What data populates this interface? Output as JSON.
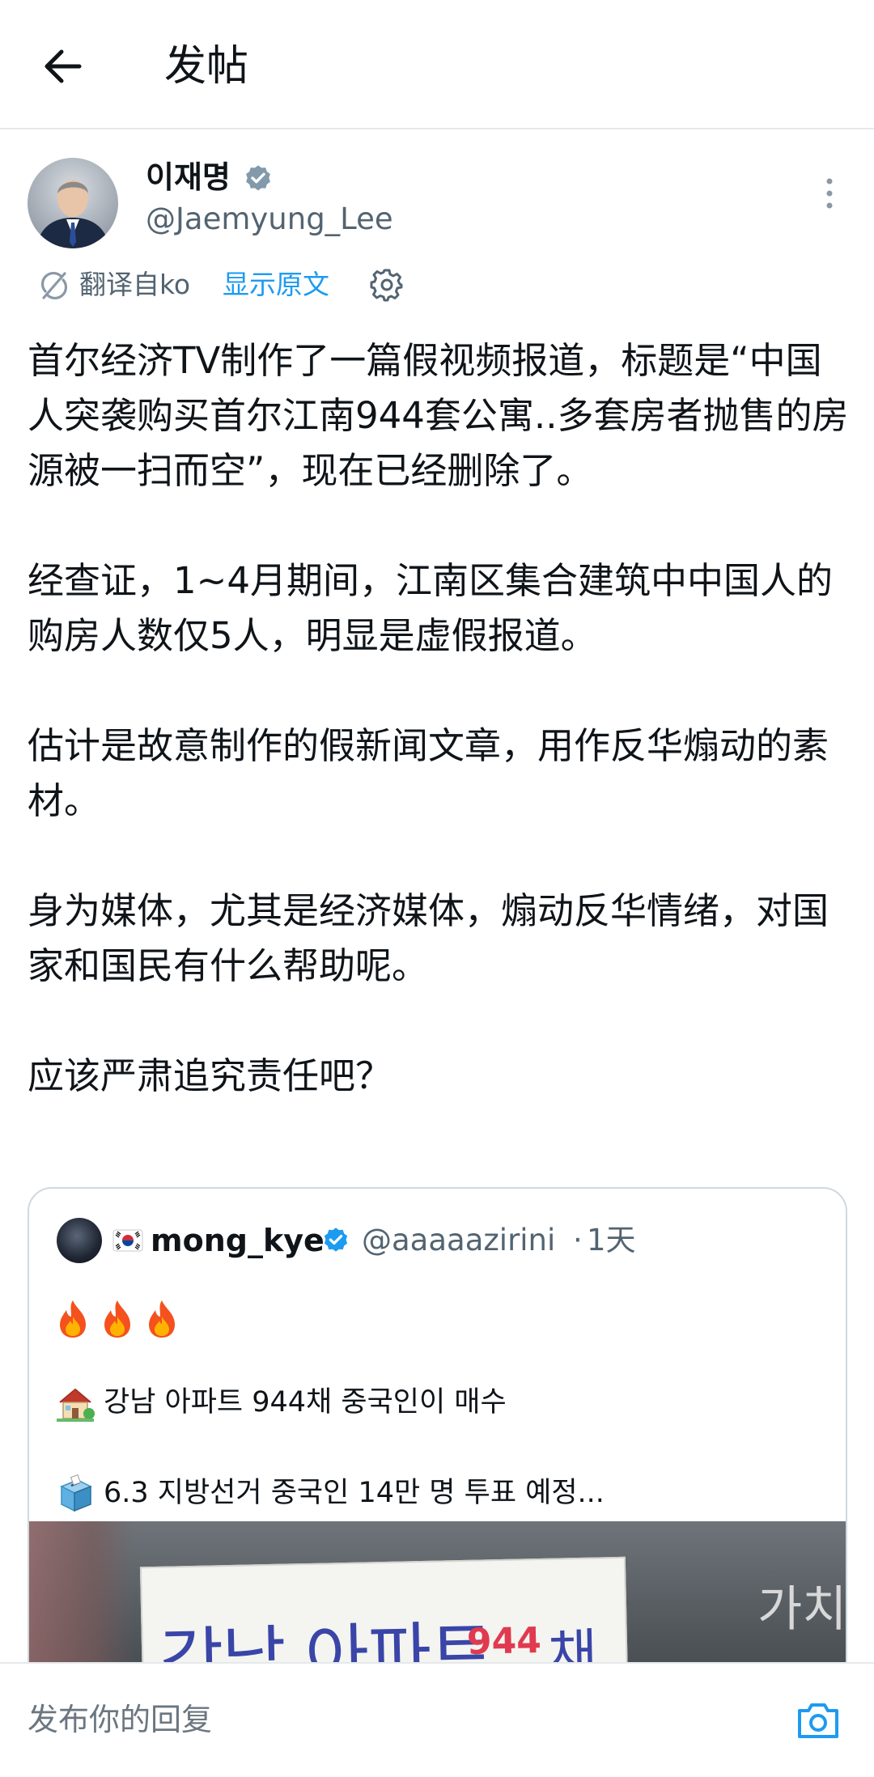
{
  "header": {
    "title": "发帖",
    "back_icon": "arrow-left-icon"
  },
  "author": {
    "name": "이재명",
    "handle": "@Jaemyung_Lee",
    "verified": true
  },
  "translation": {
    "translated_from": "翻译自ko",
    "show_original": "显示原文"
  },
  "tweet": {
    "paragraphs": [
      "首尔经济TV制作了一篇假视频报道，标题是“中国人突袭购买首尔江南944套公寓..多套房者抛售的房源被一扫而空”，现在已经删除了。",
      "经查证，1~4月期间，江南区集合建筑中中国人的购房人数仅5人，明显是虚假报道。",
      "估计是故意制作的假新闻文章，用作反华煽动的素材。",
      "身为媒体，尤其是经济媒体，煽动反华情绪，对国家和国民有什么帮助呢。",
      "应该严肃追究责任吧？"
    ]
  },
  "quote": {
    "name": "mong_kye",
    "handle": "@aaaaazirini",
    "dot": "·",
    "time": "1天",
    "line1": "강남 아파트 944채 중국인이 매수",
    "line2": "6.3 지방선거 중국인 14만 명 투표 예정...",
    "media": {
      "sign_part1": "강남 아파트",
      "sign_number": "944",
      "sign_part2": "채",
      "background_text": "가치"
    }
  },
  "reply": {
    "placeholder": "发布你的回复"
  },
  "colors": {
    "accent": "#1d9bf0",
    "secondary_text": "#536471",
    "border": "#cfd9de"
  }
}
